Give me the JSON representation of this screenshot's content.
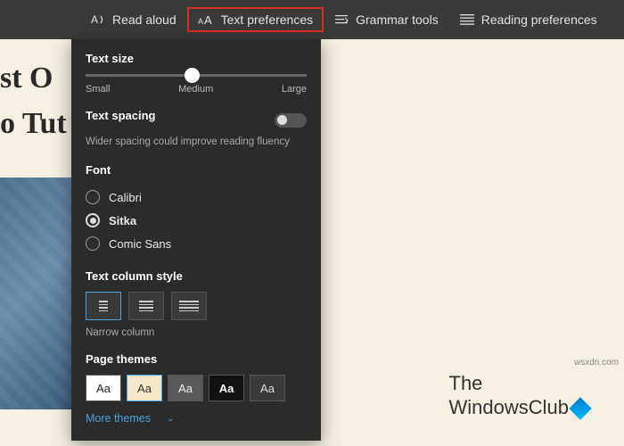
{
  "toolbar": {
    "read_aloud": "Read aloud",
    "text_preferences": "Text preferences",
    "grammar_tools": "Grammar tools",
    "reading_preferences": "Reading preferences"
  },
  "background": {
    "heading_line1": "st O",
    "heading_line2": "o Tut"
  },
  "panel": {
    "text_size": {
      "title": "Text size",
      "labels": {
        "small": "Small",
        "medium": "Medium",
        "large": "Large"
      }
    },
    "text_spacing": {
      "title": "Text spacing",
      "description": "Wider spacing could improve reading fluency"
    },
    "font": {
      "title": "Font",
      "options": [
        "Calibri",
        "Sitka",
        "Comic Sans"
      ],
      "selected": "Sitka"
    },
    "column_style": {
      "title": "Text column style",
      "current": "Narrow column"
    },
    "page_themes": {
      "title": "Page themes",
      "sample": "Aa",
      "more": "More themes"
    }
  },
  "logo": {
    "line1": "The",
    "line2": "WindowsClub"
  },
  "watermark": "wsxdn.com"
}
